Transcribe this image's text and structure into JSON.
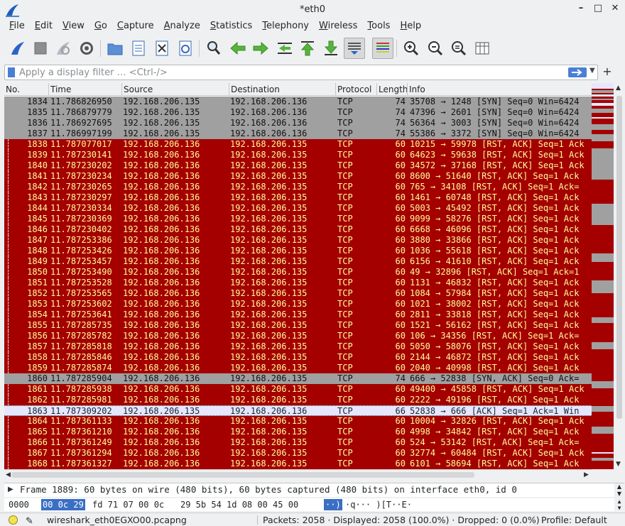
{
  "window": {
    "title": "*eth0",
    "app_icon": "wireshark-fin-icon",
    "buttons": [
      "minimize-icon",
      "maximize-icon",
      "close-icon"
    ]
  },
  "menubar": [
    "File",
    "Edit",
    "View",
    "Go",
    "Capture",
    "Analyze",
    "Statistics",
    "Telephony",
    "Wireless",
    "Tools",
    "Help"
  ],
  "toolbar": {
    "icons": [
      "start-capture-icon",
      "stop-capture-icon",
      "restart-capture-icon",
      "capture-options-icon",
      "open-file-icon",
      "save-file-icon",
      "close-file-icon",
      "reload-file-icon",
      "find-packet-icon",
      "go-back-icon",
      "go-forward-icon",
      "go-to-packet-icon",
      "first-packet-icon",
      "last-packet-icon",
      "autoscroll-icon",
      "colorize-icon",
      "zoom-in-icon",
      "zoom-out-icon",
      "normal-size-icon",
      "resize-columns-icon"
    ]
  },
  "filter": {
    "placeholder": "Apply a display filter … <Ctrl-/>",
    "value": "",
    "add_button": "+"
  },
  "packet_list": {
    "columns": [
      "No.",
      "Time",
      "Source",
      "Destination",
      "Protocol",
      "Length",
      "Info"
    ],
    "rows": [
      {
        "no": "1834",
        "time": "11.786826950",
        "src": "192.168.206.135",
        "dst": "192.168.206.136",
        "proto": "TCP",
        "len": "74",
        "info": "35708 → 1248 [SYN] Seq=0 Win=6424",
        "style": "syn"
      },
      {
        "no": "1835",
        "time": "11.786879779",
        "src": "192.168.206.135",
        "dst": "192.168.206.136",
        "proto": "TCP",
        "len": "74",
        "info": "47396 → 2601 [SYN] Seq=0 Win=6424",
        "style": "syn"
      },
      {
        "no": "1836",
        "time": "11.786927695",
        "src": "192.168.206.135",
        "dst": "192.168.206.136",
        "proto": "TCP",
        "len": "74",
        "info": "56364 → 3003 [SYN] Seq=0 Win=6424",
        "style": "syn"
      },
      {
        "no": "1837",
        "time": "11.786997199",
        "src": "192.168.206.135",
        "dst": "192.168.206.136",
        "proto": "TCP",
        "len": "74",
        "info": "55386 → 3372 [SYN] Seq=0 Win=6424",
        "style": "syn"
      },
      {
        "no": "1838",
        "time": "11.787077017",
        "src": "192.168.206.136",
        "dst": "192.168.206.135",
        "proto": "TCP",
        "len": "60",
        "info": "10215 → 59978 [RST, ACK] Seq=1 Ack",
        "style": "rst"
      },
      {
        "no": "1839",
        "time": "11.787230141",
        "src": "192.168.206.136",
        "dst": "192.168.206.135",
        "proto": "TCP",
        "len": "60",
        "info": "64623 → 59638 [RST, ACK] Seq=1 Ack",
        "style": "rst"
      },
      {
        "no": "1840",
        "time": "11.787230202",
        "src": "192.168.206.136",
        "dst": "192.168.206.135",
        "proto": "TCP",
        "len": "60",
        "info": "34572 → 37168 [RST, ACK] Seq=1 Ack",
        "style": "rst"
      },
      {
        "no": "1841",
        "time": "11.787230234",
        "src": "192.168.206.136",
        "dst": "192.168.206.135",
        "proto": "TCP",
        "len": "60",
        "info": "8600 → 51640 [RST, ACK] Seq=1 Ack",
        "style": "rst"
      },
      {
        "no": "1842",
        "time": "11.787230265",
        "src": "192.168.206.136",
        "dst": "192.168.206.135",
        "proto": "TCP",
        "len": "60",
        "info": "765 → 34108 [RST, ACK] Seq=1 Ack=",
        "style": "rst"
      },
      {
        "no": "1843",
        "time": "11.787230297",
        "src": "192.168.206.136",
        "dst": "192.168.206.135",
        "proto": "TCP",
        "len": "60",
        "info": "1461 → 60748 [RST, ACK] Seq=1 Ack",
        "style": "rst"
      },
      {
        "no": "1844",
        "time": "11.787230334",
        "src": "192.168.206.136",
        "dst": "192.168.206.135",
        "proto": "TCP",
        "len": "60",
        "info": "5003 → 45492 [RST, ACK] Seq=1 Ack",
        "style": "rst"
      },
      {
        "no": "1845",
        "time": "11.787230369",
        "src": "192.168.206.136",
        "dst": "192.168.206.135",
        "proto": "TCP",
        "len": "60",
        "info": "9099 → 58276 [RST, ACK] Seq=1 Ack",
        "style": "rst"
      },
      {
        "no": "1846",
        "time": "11.787230402",
        "src": "192.168.206.136",
        "dst": "192.168.206.135",
        "proto": "TCP",
        "len": "60",
        "info": "6668 → 46096 [RST, ACK] Seq=1 Ack",
        "style": "rst"
      },
      {
        "no": "1847",
        "time": "11.787253386",
        "src": "192.168.206.136",
        "dst": "192.168.206.135",
        "proto": "TCP",
        "len": "60",
        "info": "3880 → 33866 [RST, ACK] Seq=1 Ack",
        "style": "rst"
      },
      {
        "no": "1848",
        "time": "11.787253426",
        "src": "192.168.206.136",
        "dst": "192.168.206.135",
        "proto": "TCP",
        "len": "60",
        "info": "1036 → 55618 [RST, ACK] Seq=1 Ack",
        "style": "rst"
      },
      {
        "no": "1849",
        "time": "11.787253457",
        "src": "192.168.206.136",
        "dst": "192.168.206.135",
        "proto": "TCP",
        "len": "60",
        "info": "6156 → 41610 [RST, ACK] Seq=1 Ack",
        "style": "rst"
      },
      {
        "no": "1850",
        "time": "11.787253490",
        "src": "192.168.206.136",
        "dst": "192.168.206.135",
        "proto": "TCP",
        "len": "60",
        "info": "49 → 32896 [RST, ACK] Seq=1 Ack=1",
        "style": "rst"
      },
      {
        "no": "1851",
        "time": "11.787253528",
        "src": "192.168.206.136",
        "dst": "192.168.206.135",
        "proto": "TCP",
        "len": "60",
        "info": "1131 → 46832 [RST, ACK] Seq=1 Ack",
        "style": "rst"
      },
      {
        "no": "1852",
        "time": "11.787253565",
        "src": "192.168.206.136",
        "dst": "192.168.206.135",
        "proto": "TCP",
        "len": "60",
        "info": "1084 → 57984 [RST, ACK] Seq=1 Ack",
        "style": "rst"
      },
      {
        "no": "1853",
        "time": "11.787253602",
        "src": "192.168.206.136",
        "dst": "192.168.206.135",
        "proto": "TCP",
        "len": "60",
        "info": "1021 → 38002 [RST, ACK] Seq=1 Ack",
        "style": "rst"
      },
      {
        "no": "1854",
        "time": "11.787253641",
        "src": "192.168.206.136",
        "dst": "192.168.206.135",
        "proto": "TCP",
        "len": "60",
        "info": "2811 → 33818 [RST, ACK] Seq=1 Ack",
        "style": "rst"
      },
      {
        "no": "1855",
        "time": "11.787285735",
        "src": "192.168.206.136",
        "dst": "192.168.206.135",
        "proto": "TCP",
        "len": "60",
        "info": "1521 → 56162 [RST, ACK] Seq=1 Ack",
        "style": "rst"
      },
      {
        "no": "1856",
        "time": "11.787285782",
        "src": "192.168.206.136",
        "dst": "192.168.206.135",
        "proto": "TCP",
        "len": "60",
        "info": "106 → 34356 [RST, ACK] Seq=1 Ack=",
        "style": "rst"
      },
      {
        "no": "1857",
        "time": "11.787285818",
        "src": "192.168.206.136",
        "dst": "192.168.206.135",
        "proto": "TCP",
        "len": "60",
        "info": "5050 → 58076 [RST, ACK] Seq=1 Ack",
        "style": "rst"
      },
      {
        "no": "1858",
        "time": "11.787285846",
        "src": "192.168.206.136",
        "dst": "192.168.206.135",
        "proto": "TCP",
        "len": "60",
        "info": "2144 → 46872 [RST, ACK] Seq=1 Ack",
        "style": "rst"
      },
      {
        "no": "1859",
        "time": "11.787285874",
        "src": "192.168.206.136",
        "dst": "192.168.206.135",
        "proto": "TCP",
        "len": "60",
        "info": "2040 → 40998 [RST, ACK] Seq=1 Ack",
        "style": "rst"
      },
      {
        "no": "1860",
        "time": "11.787285904",
        "src": "192.168.206.136",
        "dst": "192.168.206.135",
        "proto": "TCP",
        "len": "74",
        "info": "666 → 52838 [SYN, ACK] Seq=0 Ack=",
        "style": "syn"
      },
      {
        "no": "1861",
        "time": "11.787285938",
        "src": "192.168.206.136",
        "dst": "192.168.206.135",
        "proto": "TCP",
        "len": "60",
        "info": "49400 → 45858 [RST, ACK] Seq=1 Ack",
        "style": "rst"
      },
      {
        "no": "1862",
        "time": "11.787285981",
        "src": "192.168.206.136",
        "dst": "192.168.206.135",
        "proto": "TCP",
        "len": "60",
        "info": "2222 → 49196 [RST, ACK] Seq=1 Ack",
        "style": "rst"
      },
      {
        "no": "1863",
        "time": "11.787309202",
        "src": "192.168.206.135",
        "dst": "192.168.206.136",
        "proto": "TCP",
        "len": "66",
        "info": "52838 → 666 [ACK] Seq=1 Ack=1 Win",
        "style": "ack"
      },
      {
        "no": "1864",
        "time": "11.787361133",
        "src": "192.168.206.136",
        "dst": "192.168.206.135",
        "proto": "TCP",
        "len": "60",
        "info": "10004 → 32826 [RST, ACK] Seq=1 Ack",
        "style": "rst"
      },
      {
        "no": "1865",
        "time": "11.787361210",
        "src": "192.168.206.136",
        "dst": "192.168.206.135",
        "proto": "TCP",
        "len": "60",
        "info": "4998 → 34842 [RST, ACK] Seq=1 Ack",
        "style": "rst"
      },
      {
        "no": "1866",
        "time": "11.787361249",
        "src": "192.168.206.136",
        "dst": "192.168.206.135",
        "proto": "TCP",
        "len": "60",
        "info": "524 → 53142 [RST, ACK] Seq=1 Ack=",
        "style": "rst"
      },
      {
        "no": "1867",
        "time": "11.787361294",
        "src": "192.168.206.136",
        "dst": "192.168.206.135",
        "proto": "TCP",
        "len": "60",
        "info": "32774 → 60484 [RST, ACK] Seq=1 Ack",
        "style": "rst"
      },
      {
        "no": "1868",
        "time": "11.787361327",
        "src": "192.168.206.136",
        "dst": "192.168.206.135",
        "proto": "TCP",
        "len": "60",
        "info": "6101 → 58694 [RST, ACK] Seq=1 Ack",
        "style": "rst"
      }
    ]
  },
  "details": {
    "line": "Frame 1889: 60 bytes on wire (480 bits), 60 bytes captured (480 bits) on interface eth0, id 0"
  },
  "bytes": {
    "offset": "0000",
    "hex_selected": "00 0c 29",
    "hex_rest_1": "fd 71 07 00 0c",
    "hex_rest_2": "29 5b 54 1d 08 00 45 00",
    "ascii_selected": "··)",
    "ascii_rest": "·q··· )[T··E·"
  },
  "status": {
    "file": "wireshark_eth0EGXO00.pcapng",
    "packets": "Packets: 2058 · Displayed: 2058 (100.0%) · Dropped: 0 (0.0%)",
    "profile": "Profile: Default"
  },
  "colors": {
    "rst_bg": "#a40000",
    "rst_fg": "#fffc9c",
    "syn_bg": "#a0a0a0",
    "ack_bg": "#e7e6ff"
  }
}
